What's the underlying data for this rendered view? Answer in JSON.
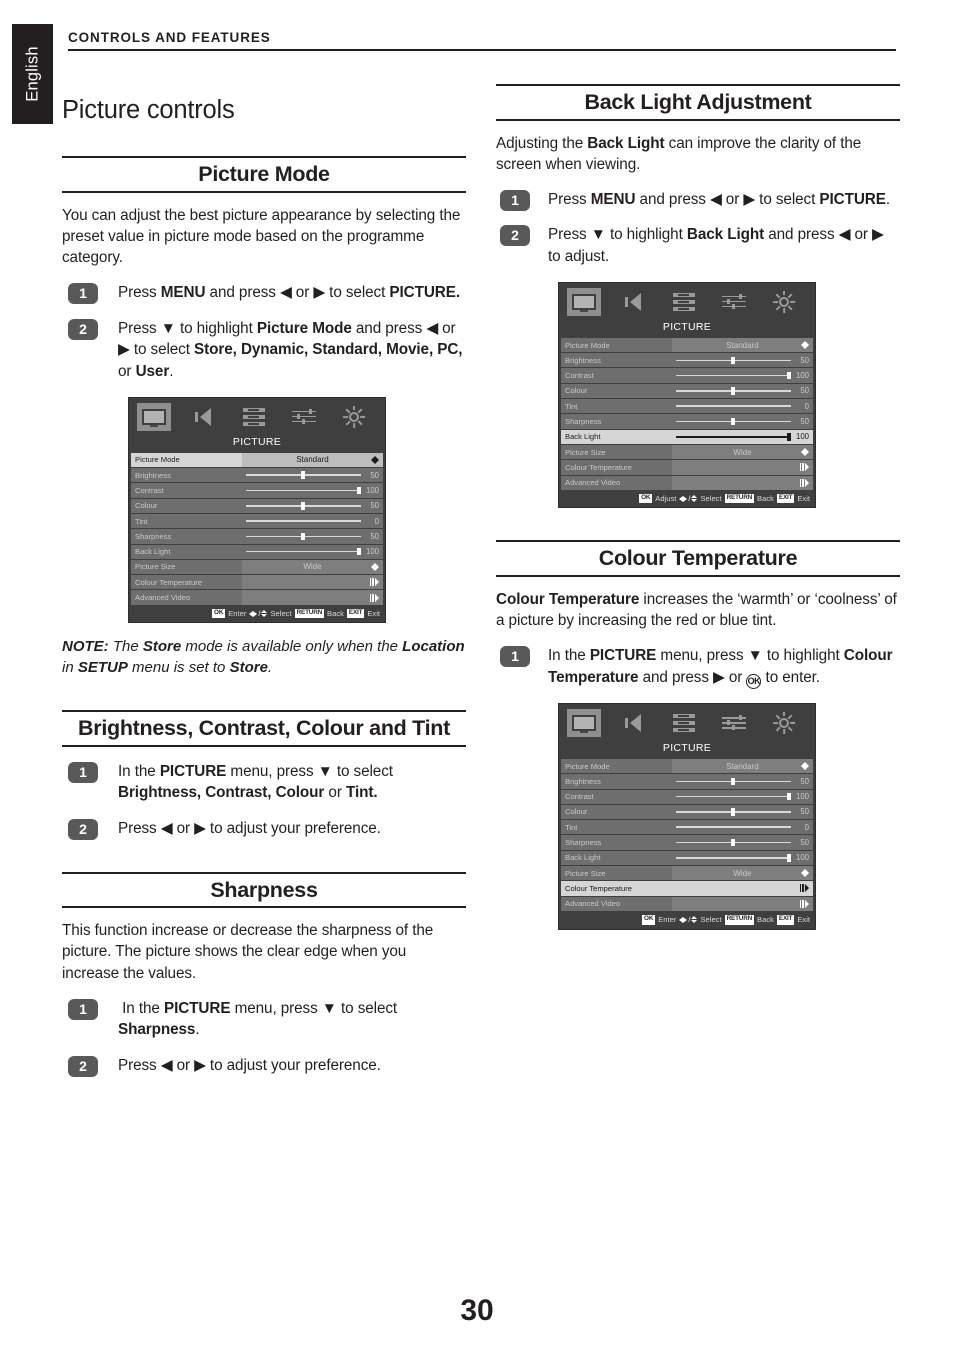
{
  "language_tab": "English",
  "running_head": "CONTROLS AND FEATURES",
  "chapter_title": "Picture controls",
  "page_number": "30",
  "sections": {
    "picture_mode": {
      "heading": "Picture Mode",
      "intro": "You can adjust the best picture appearance by selecting the preset value in picture mode based on the programme category.",
      "steps": [
        {
          "num": "1",
          "text_html": "Press <b>MENU</b> and press ◀ or ▶ to select <b>PICTURE.</b>"
        },
        {
          "num": "2",
          "text_html": "Press ▼ to highlight <b>Picture Mode</b> and press ◀ or ▶ to select <b>Store, Dynamic, Standard, Movie, PC,</b> or <b>User</b>."
        }
      ],
      "note_html": "<b>NOTE:</b> The <b>Store</b> mode is available only when the <b>Location</b> in <b>SETUP</b> menu is set to <b>Store</b>."
    },
    "bct": {
      "heading": "Brightness, Contrast, Colour and Tint",
      "steps": [
        {
          "num": "1",
          "text_html": "In the <b>PICTURE</b> menu, press ▼ to select <b>Brightness, Contrast, Colour</b> or <b>Tint.</b>"
        },
        {
          "num": "2",
          "text_html": "Press ◀ or ▶ to adjust your preference."
        }
      ]
    },
    "sharpness": {
      "heading": "Sharpness",
      "intro": "This function increase or decrease the sharpness of the picture. The picture shows the clear edge when you increase the values.",
      "steps": [
        {
          "num": "1",
          "text_html": "&nbsp;In the <b>PICTURE</b> menu, press ▼ to select <b>Sharpness</b>."
        },
        {
          "num": "2",
          "text_html": "Press ◀ or ▶ to adjust your preference."
        }
      ]
    },
    "back_light": {
      "heading": "Back Light Adjustment",
      "intro_html": "Adjusting the <b>Back Light</b> can improve the clarity of the screen when viewing.",
      "steps": [
        {
          "num": "1",
          "text_html": "Press <b>MENU</b> and press ◀ or ▶ to select <b>PICTURE</b>."
        },
        {
          "num": "2",
          "text_html": "Press ▼ to highlight <b>Back Light</b> and press ◀ or ▶ to adjust."
        }
      ]
    },
    "colour_temperature": {
      "heading": "Colour Temperature",
      "intro_html": "<b>Colour Temperature</b> increases the ‘warmth’ or ‘coolness’ of a picture by increasing the red or blue tint.",
      "steps": [
        {
          "num": "1",
          "text_html": "In the <b>PICTURE</b> menu, press ▼ to highlight <b>Colour Temperature</b> and press ▶ or <span class=\"ok-glyph\">OK</span> to enter."
        }
      ]
    }
  },
  "osd_common": {
    "title": "PICTURE",
    "icons": [
      {
        "name": "picture-icon",
        "selected": true
      },
      {
        "name": "sound-icon",
        "selected": false
      },
      {
        "name": "list-icon",
        "selected": false
      },
      {
        "name": "settings-sliders-icon",
        "selected": false
      },
      {
        "name": "brightness-sun-icon",
        "selected": false
      }
    ],
    "rows": [
      {
        "label": "Picture Mode",
        "kind": "option",
        "value": "Standard"
      },
      {
        "label": "Brightness",
        "kind": "slider",
        "value": "50",
        "pct": 50
      },
      {
        "label": "Contrast",
        "kind": "slider",
        "value": "100",
        "pct": 100
      },
      {
        "label": "Colour",
        "kind": "slider",
        "value": "50",
        "pct": 50
      },
      {
        "label": "Tint",
        "kind": "slider",
        "value": "0",
        "pct": 0
      },
      {
        "label": "Sharpness",
        "kind": "slider",
        "value": "50",
        "pct": 50
      },
      {
        "label": "Back Light",
        "kind": "slider",
        "value": "100",
        "pct": 100
      },
      {
        "label": "Picture Size",
        "kind": "option",
        "value": "Wide"
      },
      {
        "label": "Colour Temperature",
        "kind": "submenu",
        "value": ""
      },
      {
        "label": "Advanced Video",
        "kind": "submenu",
        "value": ""
      }
    ],
    "footer_keys": [
      {
        "cap": "OK",
        "label": "Enter"
      },
      {
        "cap": "DPAD",
        "label": "Select"
      },
      {
        "cap": "RETURN",
        "label": "Back"
      },
      {
        "cap": "EXIT",
        "label": "Exit"
      }
    ]
  },
  "osd_instances": [
    {
      "id": "osd-picture-mode",
      "highlight_index": 0,
      "first_action_label": "Enter"
    },
    {
      "id": "osd-back-light",
      "highlight_index": 6,
      "first_action_label": "Adjust"
    },
    {
      "id": "osd-colour-temperature",
      "highlight_index": 8,
      "first_action_label": "Enter"
    }
  ],
  "colors": {
    "ink": "#231f20",
    "osd_background": "#3f3f3f",
    "osd_row": "#6e6e6e",
    "osd_row_value": "#7e7e7e",
    "osd_row_highlight": "#d5d5d5",
    "badge": "#595959"
  }
}
